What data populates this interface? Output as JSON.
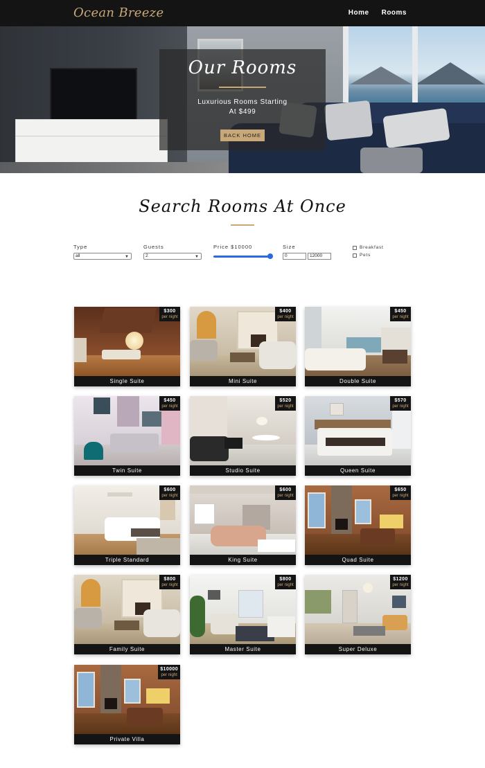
{
  "nav": {
    "logo": "Ocean Breeze",
    "links": [
      "Home",
      "Rooms"
    ]
  },
  "hero": {
    "title": "Our Rooms",
    "subtitle_line1": "Luxurious Rooms Starting",
    "subtitle_line2": "At $499",
    "button": "BACK HOME"
  },
  "search": {
    "title": "Search Rooms At Once",
    "type": {
      "label": "Type",
      "value": "all"
    },
    "guests": {
      "label": "Guests",
      "value": "2"
    },
    "price": {
      "label": "Price $10000",
      "value_fraction": 1.0
    },
    "size": {
      "label": "Size",
      "min": "0",
      "max": "12000"
    },
    "checks": [
      {
        "label": "Breakfast",
        "checked": false
      },
      {
        "label": "Pets",
        "checked": false
      }
    ]
  },
  "per_night": "per night",
  "rooms": [
    {
      "name": "Single Suite",
      "price": "$300"
    },
    {
      "name": "Mini Suite",
      "price": "$400"
    },
    {
      "name": "Double Suite",
      "price": "$450"
    },
    {
      "name": "Twin Suite",
      "price": "$450"
    },
    {
      "name": "Studio Suite",
      "price": "$520"
    },
    {
      "name": "Queen Suite",
      "price": "$570"
    },
    {
      "name": "Triple Standard",
      "price": "$600"
    },
    {
      "name": "King Suite",
      "price": "$600"
    },
    {
      "name": "Quad Suite",
      "price": "$650"
    },
    {
      "name": "Family Suite",
      "price": "$800"
    },
    {
      "name": "Master Suite",
      "price": "$800"
    },
    {
      "name": "Super Deluxe",
      "price": "$1200"
    },
    {
      "name": "Private Villa",
      "price": "$10000"
    }
  ],
  "colors": {
    "accent": "#c8a878",
    "dark": "#141414",
    "slider": "#2a6ae0"
  }
}
